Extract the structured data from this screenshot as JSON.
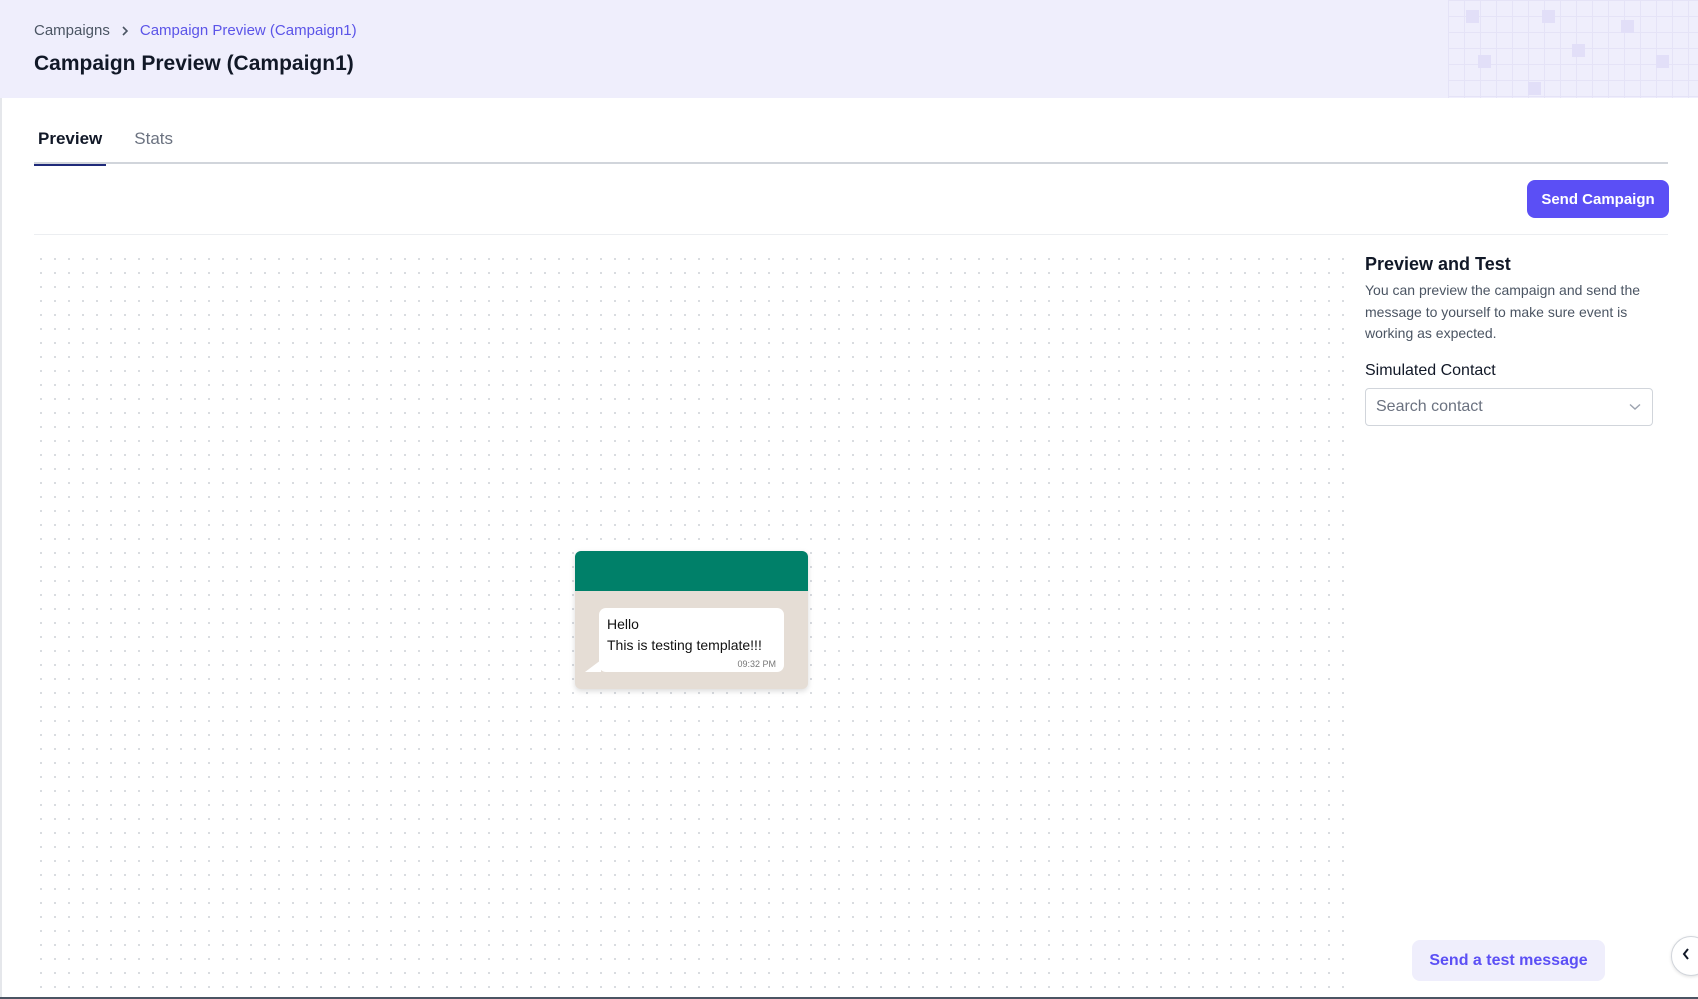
{
  "breadcrumb": {
    "parent": "Campaigns",
    "current": "Campaign Preview (Campaign1)"
  },
  "page": {
    "title": "Campaign Preview (Campaign1)"
  },
  "tabs": [
    {
      "label": "Preview",
      "active": true
    },
    {
      "label": "Stats",
      "active": false
    }
  ],
  "actions": {
    "send_campaign": "Send Campaign",
    "send_test": "Send a test message"
  },
  "preview": {
    "message_lines": [
      "Hello",
      "This is testing template!!!"
    ],
    "time": "09:32 PM"
  },
  "panel": {
    "title": "Preview and Test",
    "description": "You can preview the campaign and send the message to yourself to make sure event is working as expected.",
    "contact_label": "Simulated Contact",
    "contact_placeholder": "Search contact"
  },
  "colors": {
    "accent": "#5b4ff5",
    "header_bg": "#efeefc",
    "whatsapp_green": "#008069",
    "chat_bg": "#e5ddd5"
  },
  "icons": {
    "breadcrumb_separator": "chevron-right-icon",
    "select": "chevron-down-icon",
    "collapse": "chevron-left-icon"
  }
}
